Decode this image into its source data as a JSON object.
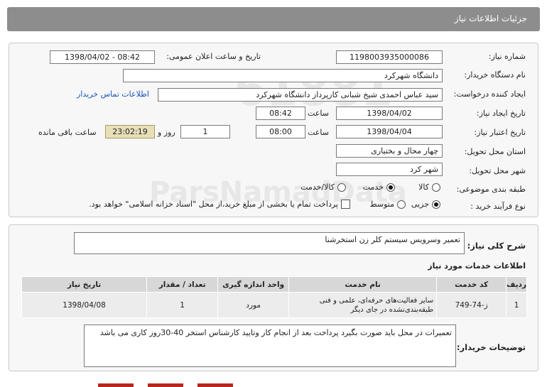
{
  "header": {
    "title": "جزئیات اطلاعات نیاز"
  },
  "form": {
    "need_number": {
      "label": "شماره نیاز:",
      "value": "1198003935000086"
    },
    "announce_date": {
      "label": "تاریخ و ساعت اعلان عمومی:",
      "value": "1398/04/02 - 08:42"
    },
    "buyer_org": {
      "label": "نام دستگاه خریدار:",
      "value": "دانشگاه شهرکرد"
    },
    "requester": {
      "label": "ایجاد کننده درخواست:",
      "value": "سید عباس احمدی شیخ شبانی کارپرداز دانشگاه شهرکرد",
      "contact_link": "اطلاعات تماس خریدار"
    },
    "created": {
      "label": "تاریخ ایجاد نیاز:",
      "date": "1398/04/02",
      "time_label": "ساعت",
      "time": "08:42"
    },
    "validity": {
      "label": "تاریخ اعتبار نیاز:",
      "date": "1398/04/04",
      "time_label": "ساعت",
      "time": "08:00",
      "days": "1",
      "days_label": "روز و",
      "remaining": "23:02:19",
      "remaining_label": "ساعت باقی مانده"
    },
    "province": {
      "label": "استان محل تحویل:",
      "value": "چهار محال و بختیاری"
    },
    "city": {
      "label": "شهر محل تحویل:",
      "value": "شهر کرد"
    },
    "category": {
      "label": "طبقه بندی موضوعی:",
      "options": [
        "کالا",
        "خدمت",
        "کالا/خدمت"
      ],
      "selected": "خدمت"
    },
    "process": {
      "label": "نوع فرآیند خرید :",
      "options": [
        "جزیی",
        "متوسط"
      ],
      "selected": "جزیی",
      "payment_note": "پرداخت تمام یا بخشی از مبلغ خرید،از محل \"اسناد خزانه اسلامی\" خواهد بود."
    }
  },
  "summary": {
    "label": "شرح کلی نیاز:",
    "value": "تعمیر وسرویس سیستم کلر زن استخرشنا"
  },
  "services": {
    "title": "اطلاعات خدمات مورد نیاز",
    "columns": [
      "ردیف",
      "کد خدمت",
      "نام خدمت",
      "واحد اندازه گیری",
      "تعداد / مقدار",
      "تاریخ نیاز"
    ],
    "rows": [
      [
        "1",
        "ز-74-749",
        "سایر فعالیت‌های حرفه‌ای، علمی و فنی طبقه‌بندی‌نشده در جای دیگر",
        "مورد",
        "1",
        "1398/04/08"
      ]
    ]
  },
  "buyer_notes": {
    "label": "توضیحات خریدار:",
    "value": "تعمیرات در محل باید صورت بگیرد پرداخت بعد از انجام کار وتایید کارشناس استخر 40-30روز کاری می باشد"
  }
}
